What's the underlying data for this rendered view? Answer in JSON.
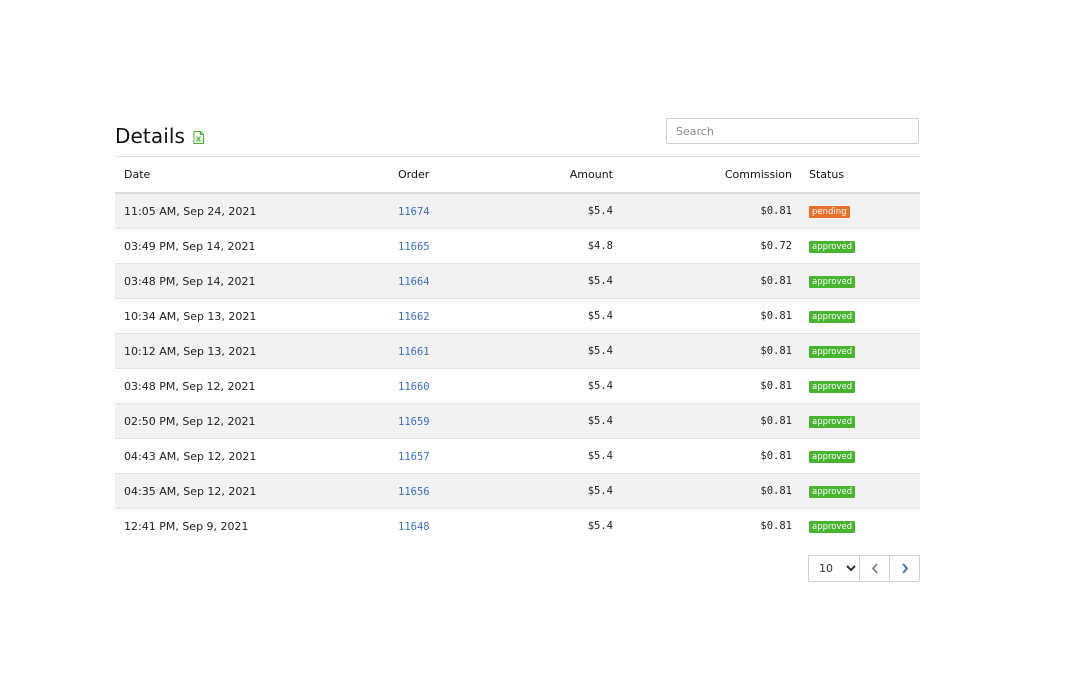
{
  "header": {
    "title": "Details",
    "export_icon": "excel-icon",
    "search_placeholder": "Search"
  },
  "table": {
    "columns": {
      "date": "Date",
      "order": "Order",
      "amount": "Amount",
      "commission": "Commission",
      "status": "Status"
    },
    "rows": [
      {
        "date": "11:05 AM, Sep 24, 2021",
        "order": "11674",
        "amount": "$5.4",
        "commission": "$0.81",
        "status": "pending"
      },
      {
        "date": "03:49 PM, Sep 14, 2021",
        "order": "11665",
        "amount": "$4.8",
        "commission": "$0.72",
        "status": "approved"
      },
      {
        "date": "03:48 PM, Sep 14, 2021",
        "order": "11664",
        "amount": "$5.4",
        "commission": "$0.81",
        "status": "approved"
      },
      {
        "date": "10:34 AM, Sep 13, 2021",
        "order": "11662",
        "amount": "$5.4",
        "commission": "$0.81",
        "status": "approved"
      },
      {
        "date": "10:12 AM, Sep 13, 2021",
        "order": "11661",
        "amount": "$5.4",
        "commission": "$0.81",
        "status": "approved"
      },
      {
        "date": "03:48 PM, Sep 12, 2021",
        "order": "11660",
        "amount": "$5.4",
        "commission": "$0.81",
        "status": "approved"
      },
      {
        "date": "02:50 PM, Sep 12, 2021",
        "order": "11659",
        "amount": "$5.4",
        "commission": "$0.81",
        "status": "approved"
      },
      {
        "date": "04:43 AM, Sep 12, 2021",
        "order": "11657",
        "amount": "$5.4",
        "commission": "$0.81",
        "status": "approved"
      },
      {
        "date": "04:35 AM, Sep 12, 2021",
        "order": "11656",
        "amount": "$5.4",
        "commission": "$0.81",
        "status": "approved"
      },
      {
        "date": "12:41 PM, Sep 9, 2021",
        "order": "11648",
        "amount": "$5.4",
        "commission": "$0.81",
        "status": "approved"
      }
    ]
  },
  "pagination": {
    "page_size": "10",
    "prev_icon": "chevron-left-icon",
    "next_icon": "chevron-right-icon"
  },
  "colors": {
    "pending": "#e8702a",
    "approved": "#47b530",
    "link": "#3d6fc4",
    "excel": "#47b530"
  }
}
